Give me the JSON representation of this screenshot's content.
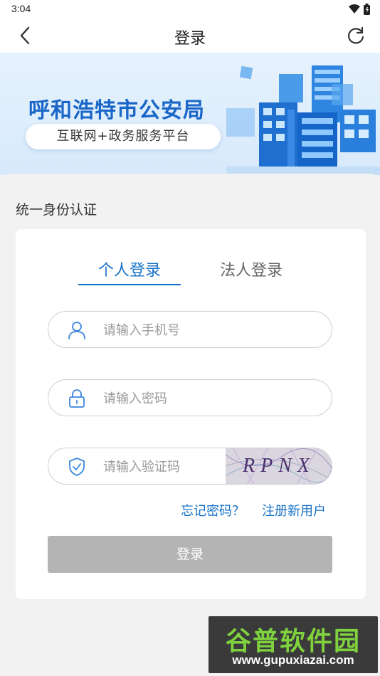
{
  "status_bar": {
    "time": "3:04",
    "icons": [
      "wifi-icon",
      "battery-icon"
    ]
  },
  "app_bar": {
    "title": "登录",
    "back_icon": "chevron-left-icon",
    "refresh_icon": "refresh-icon"
  },
  "banner": {
    "title": "呼和浩特市公安局",
    "subtitle": "互联网+政务服务平台"
  },
  "section_label": "统一身份认证",
  "tabs": [
    {
      "label": "个人登录",
      "active": true
    },
    {
      "label": "法人登录",
      "active": false
    }
  ],
  "form": {
    "phone": {
      "placeholder": "请输入手机号",
      "icon": "user-icon"
    },
    "password": {
      "placeholder": "请输入密码",
      "icon": "lock-icon"
    },
    "captcha": {
      "placeholder": "请输入验证码",
      "icon": "shield-check-icon",
      "image_text": "RPNX"
    }
  },
  "links": {
    "forgot": "忘记密码？",
    "register": "注册新用户"
  },
  "login_button": "登录",
  "colors": {
    "accent": "#1a73c9",
    "banner_title": "#1a66c8",
    "disabled_button": "#b4b4b4"
  },
  "watermark": {
    "main": "谷普软件园",
    "sub": "www.gupuxiazai.com"
  }
}
